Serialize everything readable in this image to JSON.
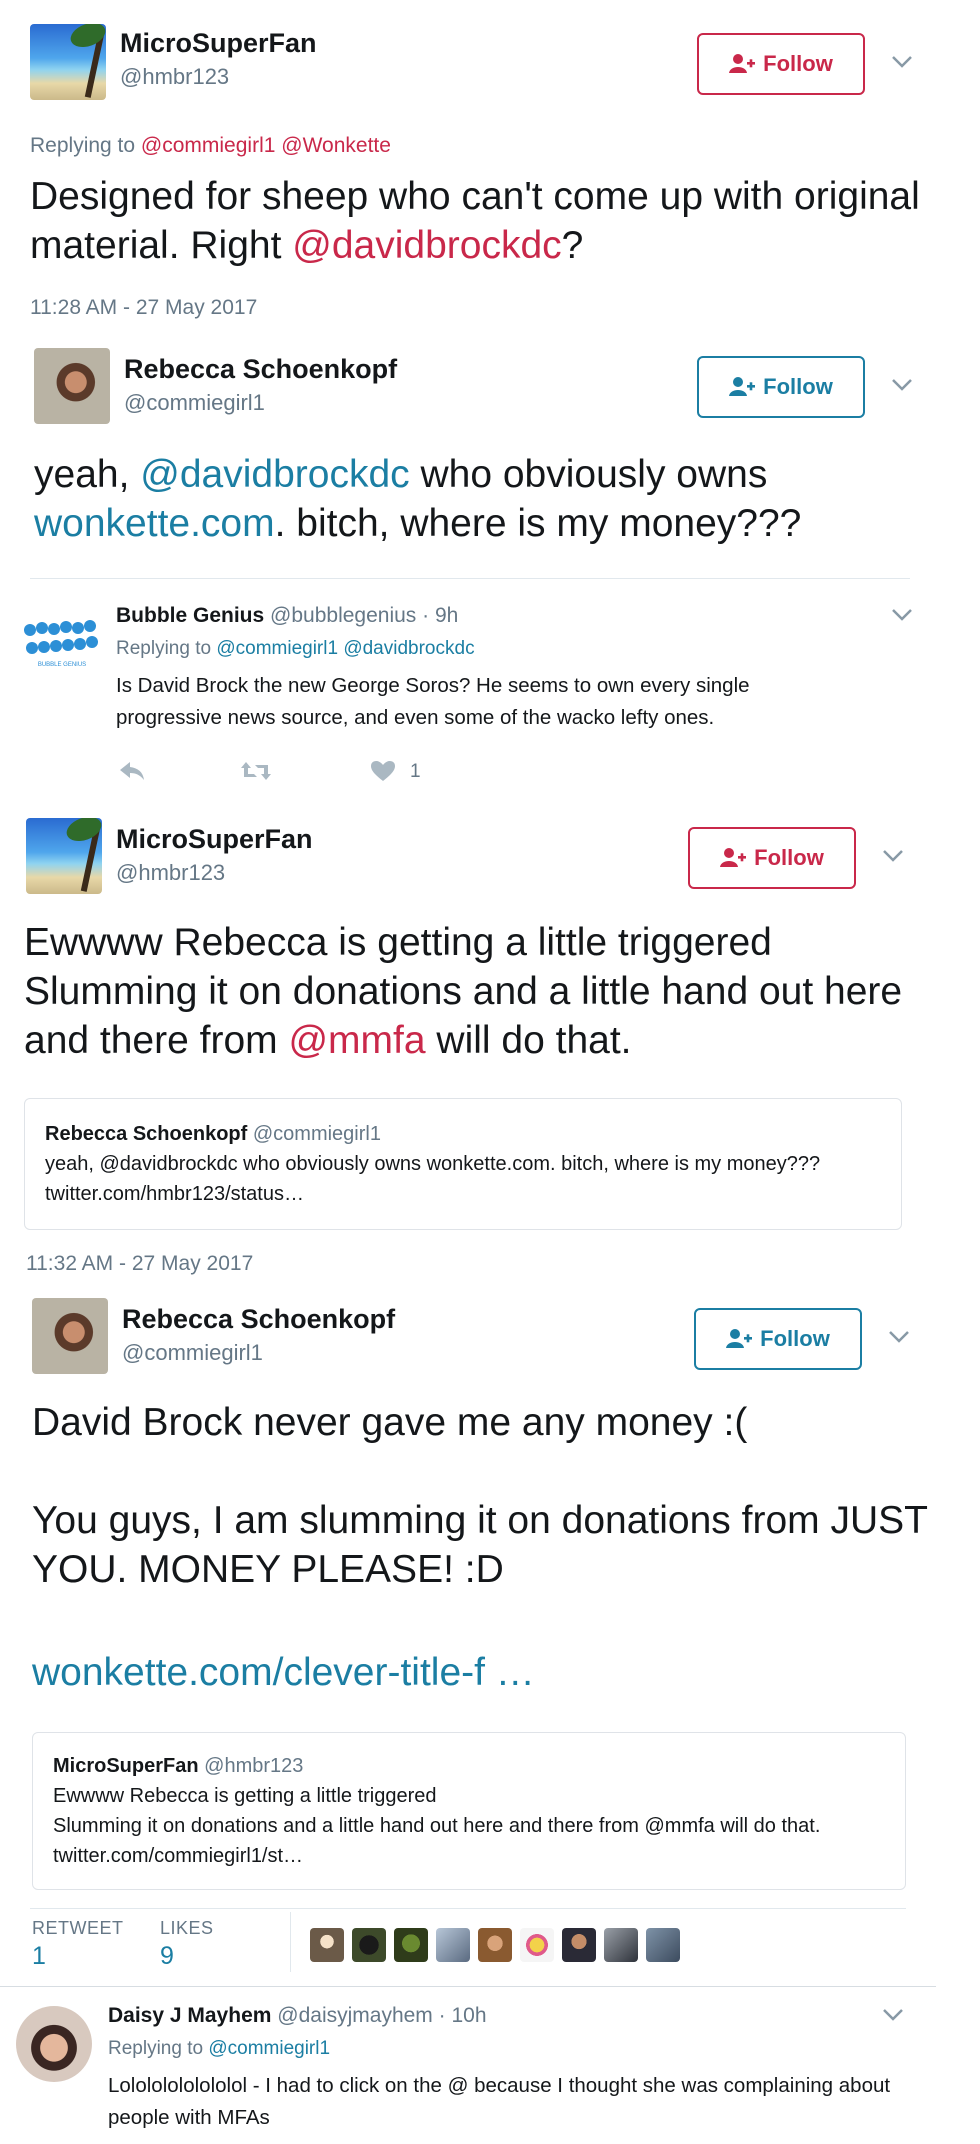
{
  "tweet1": {
    "name": "MicroSuperFan",
    "handle": "@hmbr123",
    "follow": "Follow",
    "replying_prefix": "Replying to",
    "replying_to": [
      "@commiegirl1",
      "@Wonkette"
    ],
    "text_part1": "Designed for sheep who can't come up with original material. Right ",
    "mention": "@davidbrockdc",
    "text_part2": "?",
    "timestamp": "11:28 AM - 27 May 2017"
  },
  "tweet2": {
    "name": "Rebecca Schoenkopf",
    "handle": "@commiegirl1",
    "follow": "Follow",
    "text_part1": "yeah, ",
    "mention": "@davidbrockdc",
    "text_part2": " who obviously owns ",
    "link": "wonkette.com",
    "text_part3": ". bitch, where is my money???"
  },
  "reply_bubble": {
    "name": "Bubble Genius",
    "handle": "@bubblegenius",
    "sep": "·",
    "time": "9h",
    "replying_prefix": "Replying to",
    "replying_to": [
      "@commiegirl1",
      "@davidbrockdc"
    ],
    "text": "Is David Brock the new George Soros? He seems to own every single progressive news source, and even some of the wacko lefty ones.",
    "likes": "1",
    "logo_text": "BUBBLE GENIUS"
  },
  "tweet3": {
    "name": "MicroSuperFan",
    "handle": "@hmbr123",
    "follow": "Follow",
    "line1": "Ewwww Rebecca is getting a little triggered",
    "line2": "Slumming it on donations and a little hand out here and there from ",
    "mention": "@mmfa",
    "line2_end": " will do that.",
    "quote": {
      "name": "Rebecca Schoenkopf",
      "handle": "@commiegirl1",
      "text": "yeah, @davidbrockdc who obviously owns wonkette.com. bitch, where is my money??? twitter.com/hmbr123/status…"
    },
    "timestamp": "11:32 AM - 27 May 2017"
  },
  "tweet4": {
    "name": "Rebecca Schoenkopf",
    "handle": "@commiegirl1",
    "follow": "Follow",
    "para1": "David Brock never gave me any money :(",
    "para2": "You guys, I am slumming it on donations from JUST YOU. MONEY PLEASE! :D",
    "link": "wonkette.com/clever-title-f …",
    "quote": {
      "name": "MicroSuperFan",
      "handle": "@hmbr123",
      "line1": "Ewwww Rebecca is getting a little triggered",
      "line2": "Slumming it on donations and a little hand out here and there from @mmfa will do that. twitter.com/commiegirl1/st…"
    },
    "retweet_label": "RETWEET",
    "retweet_count": "1",
    "likes_label": "LIKES",
    "likes_count": "9"
  },
  "reply_daisy": {
    "name": "Daisy J Mayhem",
    "handle": "@daisyjmayhem",
    "sep": "·",
    "time": "10h",
    "replying_prefix": "Replying to",
    "replying_to": "@commiegirl1",
    "text": "Lolololololololol - I had to click on the @ because I thought she was complaining about people with MFAs"
  },
  "colors": {
    "accent_red": "#c9284a",
    "accent_blue": "#1b7ea3",
    "muted": "#657786"
  }
}
